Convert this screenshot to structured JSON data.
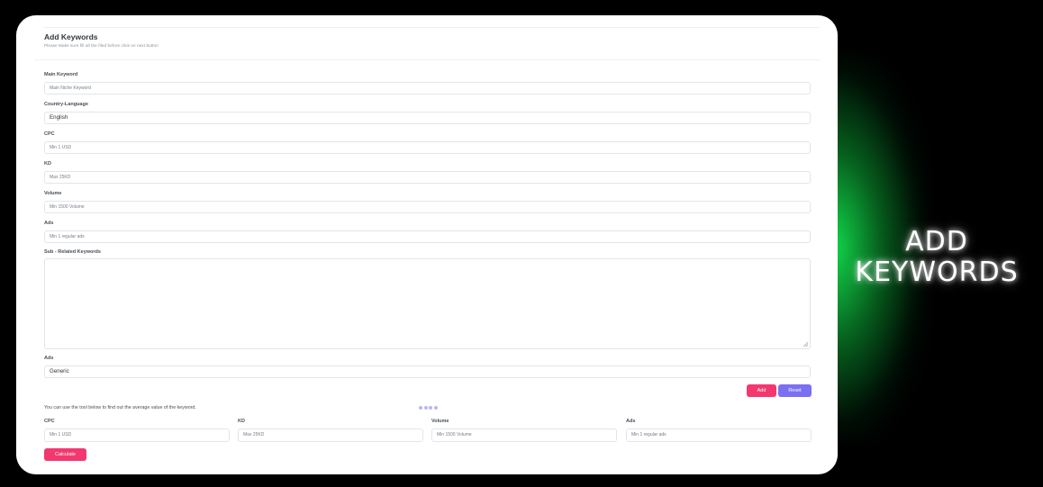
{
  "form": {
    "title": "Add Keywords",
    "subtitle": "Please Make sure fill all the filed before click on next button",
    "main_keyword": {
      "label": "Main Keyword",
      "placeholder": "Main Niche Keyword"
    },
    "country_language": {
      "label": "Country-Language",
      "value": "English"
    },
    "cpc": {
      "label": "CPC",
      "placeholder": "Min 1 USD"
    },
    "kd": {
      "label": "KD",
      "placeholder": "Max 25KD"
    },
    "volume": {
      "label": "Volume",
      "placeholder": "Min 1500 Volume"
    },
    "ads": {
      "label": "Ads",
      "placeholder": "Min 1 regular ads"
    },
    "sub_related": {
      "label": "Sub - Related Keywords",
      "value": ""
    },
    "ads_type": {
      "label": "Ads",
      "value": "Generic"
    },
    "add_label": "Add",
    "reset_label": "Reset"
  },
  "tool": {
    "hint": "You can use the tool below to find out the average value of the keyword.",
    "cpc": {
      "label": "CPC",
      "placeholder": "Min 1 USD"
    },
    "kd": {
      "label": "KD",
      "placeholder": "Max 25KD"
    },
    "volume": {
      "label": "Volume",
      "placeholder": "Min 1500 Volume"
    },
    "ads": {
      "label": "Ads",
      "placeholder": "Min 1 regular ads"
    },
    "calculate_label": "Calculate"
  },
  "side_title": {
    "line1": "ADD",
    "line2": "KEYWORDS"
  },
  "colors": {
    "accent_pink": "#f2386f",
    "accent_purple": "#7b6ff2",
    "glow_green": "#14e650"
  }
}
